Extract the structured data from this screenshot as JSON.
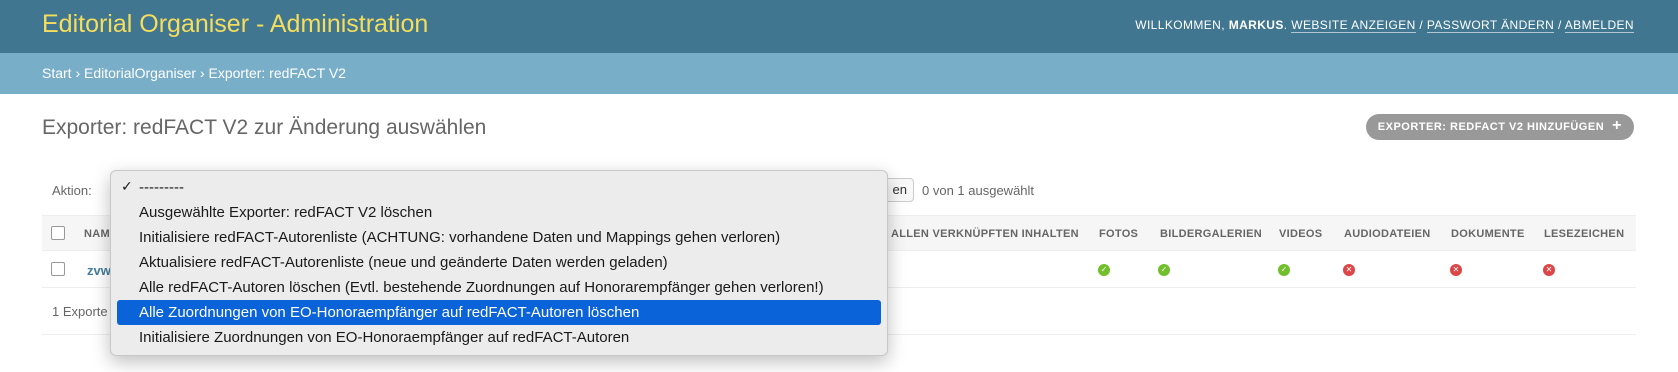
{
  "header": {
    "branding": "Editorial Organiser - Administration",
    "welcome": "WILLKOMMEN,",
    "username": "MARKUS",
    "links": [
      "WEBSITE ANZEIGEN",
      "PASSWORT ÄNDERN",
      "ABMELDEN"
    ]
  },
  "breadcrumbs": "Start › EditorialOrganiser › Exporter: redFACT V2",
  "page": {
    "title": "Exporter: redFACT V2 zur Änderung auswählen",
    "add_button": "EXPORTER: REDFACT V2 HINZUFÜGEN",
    "add_icon": "plus-icon"
  },
  "actions": {
    "label": "Aktion:",
    "go_button_partial": "en",
    "counter": "0 von 1 ausgewählt",
    "options": [
      "---------",
      "Ausgewählte Exporter: redFACT V2 löschen",
      "Initialisiere redFACT-Autorenliste (ACHTUNG: vorhandene Daten und Mappings gehen verloren)",
      "Aktualisiere redFACT-Autorenliste (neue und geänderte Daten werden geladen)",
      "Alle redFACT-Autoren löschen (Evtl. bestehende Zuordnungen auf Honorarempfänger gehen verloren!)",
      "Alle Zuordnungen von EO-Honoraempfänger auf redFACT-Autoren löschen",
      "Initialisiere Zuordnungen von EO-Honoraempfänger auf redFACT-Autoren"
    ],
    "checked_index": 0,
    "highlighted_index": 5
  },
  "table": {
    "columns": [
      "NAM",
      "ALLEN VERKNÜPFTEN INHALTEN",
      "FOTOS",
      "BILDERGALERIEN",
      "VIDEOS",
      "AUDIODATEIEN",
      "DOKUMENTE",
      "LESEZEICHEN"
    ],
    "row": {
      "name_partial": "zvw",
      "flags": [
        "yes",
        "yes",
        "yes",
        "no",
        "no",
        "no"
      ]
    }
  },
  "paginator": "1 Exporte",
  "colors": {
    "header_bg": "#417690",
    "branding": "#f5dd5d",
    "breadcrumbs_bg": "#79aec8",
    "yes_icon": "#70bf2b",
    "no_icon": "#dd4646",
    "highlight": "#0a63d8"
  }
}
